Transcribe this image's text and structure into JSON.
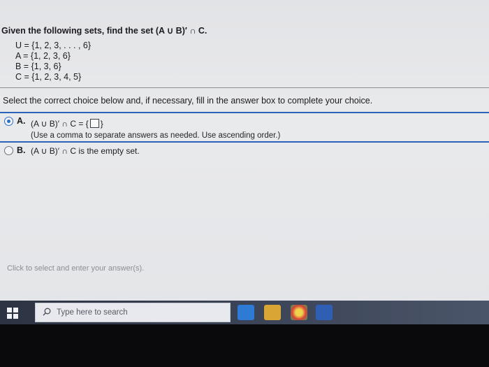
{
  "question": {
    "prompt": "Given the following sets, find the set (A ∪ B)′ ∩ C.",
    "sets": [
      "U = {1, 2, 3, . . . , 6}",
      "A = {1, 2, 3, 6}",
      "B = {1, 3, 6}",
      "C = {1, 2, 3, 4, 5}"
    ]
  },
  "instruction": "Select the correct choice below and, if necessary, fill in the answer box to complete your choice.",
  "choices": {
    "a": {
      "letter": "A.",
      "expression_prefix": "(A ∪ B)′ ∩ C = {",
      "expression_suffix": "}",
      "hint": "(Use a comma to separate answers as needed. Use ascending order.)",
      "selected": true
    },
    "b": {
      "letter": "B.",
      "text": "(A ∪ B)′ ∩ C is the empty set.",
      "selected": false
    }
  },
  "status": "Click to select and enter your answer(s).",
  "taskbar": {
    "search_placeholder": "Type here to search",
    "apps": [
      "edge-icon",
      "file-explorer-icon",
      "chrome-icon",
      "word-icon"
    ]
  }
}
